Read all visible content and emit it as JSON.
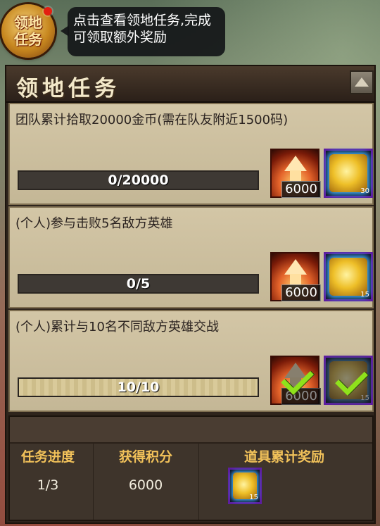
{
  "badge": {
    "label": "领地任务"
  },
  "tooltip": {
    "text": "点击查看领地任务,完成可领取额外奖励"
  },
  "panel": {
    "title": "领地任务"
  },
  "tasks": [
    {
      "title": "团队累计拾取20000金币(需在队友附近1500码)",
      "progress_text": "0/20000",
      "progress": 0,
      "exp_amount": "6000",
      "item_qty": "30",
      "completed": false
    },
    {
      "title": "(个人)参与击败5名敌方英雄",
      "progress_text": "0/5",
      "progress": 0,
      "exp_amount": "6000",
      "item_qty": "15",
      "completed": false
    },
    {
      "title": "(个人)累计与10名不同敌方英雄交战",
      "progress_text": "10/10",
      "progress": 1,
      "exp_amount": "6000",
      "item_qty": "15",
      "completed": true
    }
  ],
  "summary": {
    "progress_label": "任务进度",
    "progress_value": "1/3",
    "points_label": "获得积分",
    "points_value": "6000",
    "rewards_label": "道具累计奖励",
    "reward_item_qty": "15"
  },
  "icons": {
    "exp_reward": "upgrade-arrow-icon",
    "item_reward": "golden-scroll-icon",
    "complete": "checkmark-icon",
    "collapse": "chevron-up-icon"
  }
}
